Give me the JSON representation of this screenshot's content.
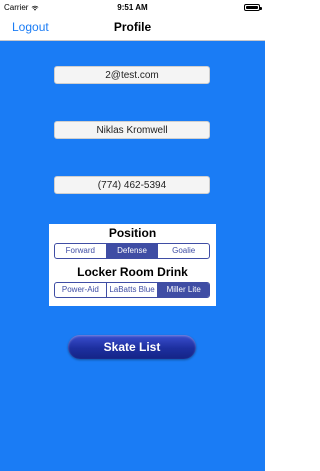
{
  "status_bar": {
    "carrier": "Carrier",
    "time": "9:51 AM",
    "battery_level": 1.0
  },
  "nav": {
    "back_label": "Logout",
    "title": "Profile"
  },
  "profile": {
    "email": "2@test.com",
    "name": "Niklas Kromwell",
    "phone": "(774) 462-5394"
  },
  "position": {
    "heading": "Position",
    "options": [
      "Forward",
      "Defense",
      "Goalie"
    ],
    "selected": "Defense"
  },
  "drink": {
    "heading": "Locker Room Drink",
    "options": [
      "Power-Aid",
      "LaBatts Blue",
      "Miller Lite"
    ],
    "selected": "Miller Lite"
  },
  "actions": {
    "skate_list_label": "Skate List"
  },
  "colors": {
    "background": "#1a7cf5",
    "segment_accent": "#3f4da4",
    "link": "#1a7cf5"
  },
  "icons": {
    "wifi": "wifi-icon",
    "battery": "battery-icon"
  }
}
